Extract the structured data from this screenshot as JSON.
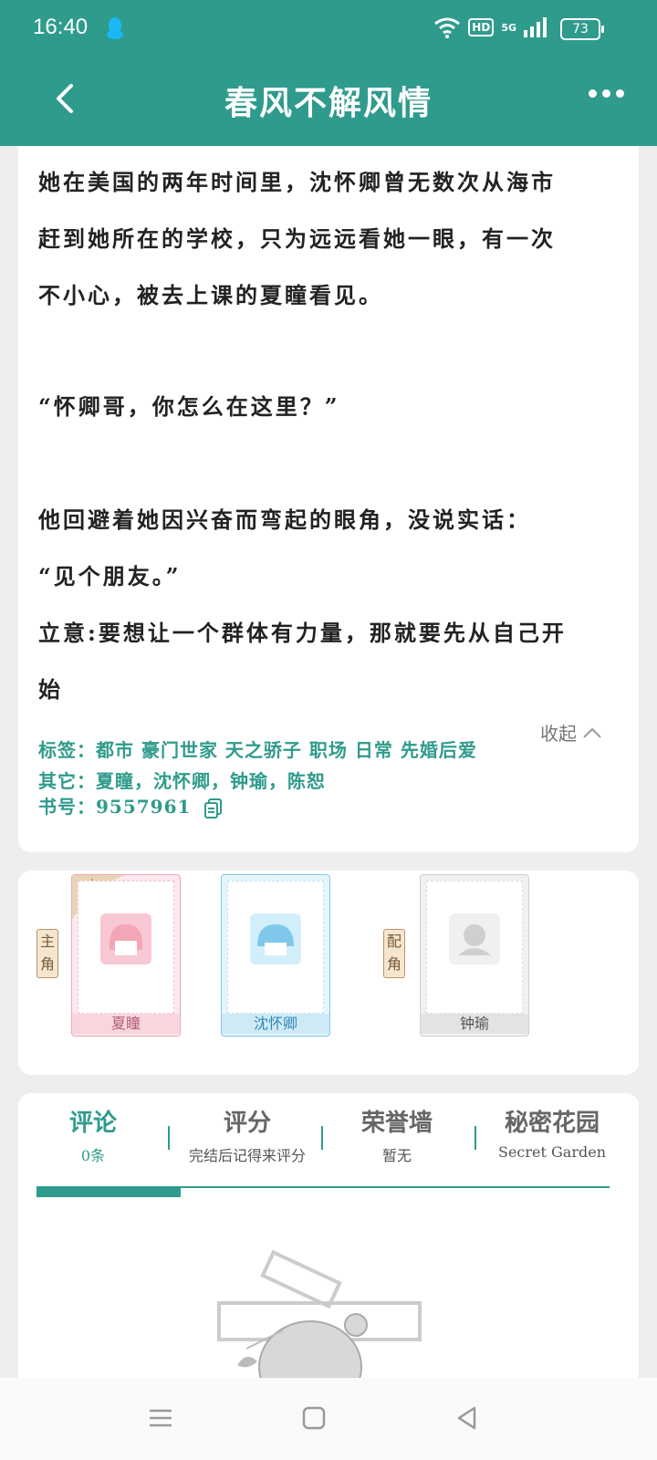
{
  "status_bar": {
    "time": "16:40",
    "hd": "HD",
    "network": "5G",
    "battery": "73"
  },
  "header": {
    "title": "春风不解风情"
  },
  "intro": {
    "paragraphs": [
      "她在美国的两年时间里，沈怀卿曾无数次从海市",
      "赶到她所在的学校，只为远远看她一眼，有一次",
      "不小心，被去上课的夏瞳看见。",
      "“怀卿哥，你怎么在这里？”",
      "他回避着她因兴奋而弯起的眼角，没说实话：",
      "“见个朋友。”",
      "立意:要想让一个群体有力量，那就要先从自己开",
      "始"
    ],
    "collapse_label": "收起",
    "tags": "标签：都市 豪门世家 天之骄子 职场 日常 先婚后爱",
    "others": "其它：夏瞳，沈怀卿，钟瑜，陈恕",
    "book_id": "书号：9557961"
  },
  "roles": {
    "main_label": "主角",
    "support_label": "配角",
    "characters": [
      "夏瞳",
      "沈怀卿",
      "钟瑜"
    ]
  },
  "tabs": [
    {
      "title": "评论",
      "sub": "0条"
    },
    {
      "title": "评分",
      "sub": "完结后记得来评分"
    },
    {
      "title": "荣誉墙",
      "sub": "暂无"
    },
    {
      "title": "秘密花园",
      "sub": "Secret Garden"
    }
  ],
  "colors": {
    "accent": "#2f9b8c",
    "female": "#f2a6b6",
    "male": "#7fc8ea",
    "neutral": "#cfcfcf"
  }
}
